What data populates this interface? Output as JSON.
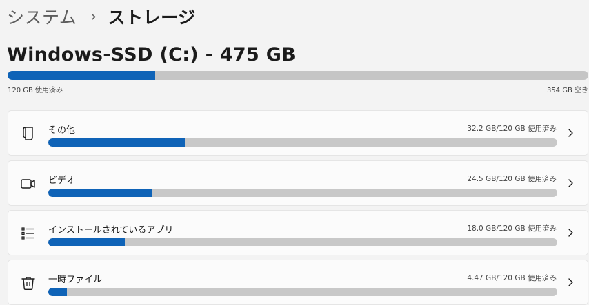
{
  "breadcrumb": {
    "parent": "システム",
    "separator": "›",
    "current": "ストレージ"
  },
  "drive": {
    "title": "Windows-SSD (C:) - 475 GB",
    "used_label": "120 GB 使用済み",
    "free_label": "354 GB 空き",
    "used_fraction": 0.254
  },
  "categories": [
    {
      "name": "その他",
      "size_label": "32.2 GB/120 GB 使用済み",
      "used_fraction": 0.268,
      "icon": "document-icon"
    },
    {
      "name": "ビデオ",
      "size_label": "24.5 GB/120 GB 使用済み",
      "used_fraction": 0.204,
      "icon": "video-icon"
    },
    {
      "name": "インストールされているアプリ",
      "size_label": "18.0 GB/120 GB 使用済み",
      "used_fraction": 0.15,
      "icon": "apps-list-icon"
    },
    {
      "name": "一時ファイル",
      "size_label": "4.47 GB/120 GB 使用済み",
      "used_fraction": 0.037,
      "icon": "trash-icon"
    }
  ],
  "colors": {
    "accent": "#0f63b7",
    "track": "#c5c5c5",
    "background": "#f3f3f3",
    "card": "#fbfbfb"
  }
}
